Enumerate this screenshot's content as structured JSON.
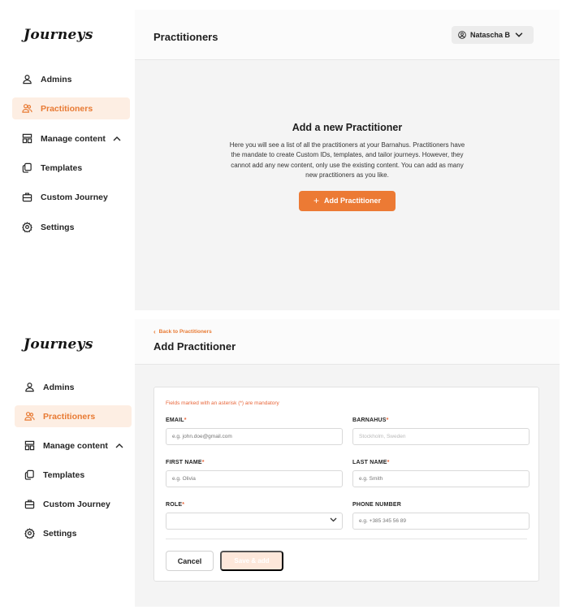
{
  "app": {
    "logo": "Journeys"
  },
  "sidebar": {
    "items": [
      {
        "label": "Admins",
        "icon": "user-icon"
      },
      {
        "label": "Practitioners",
        "icon": "users-icon"
      },
      {
        "label": "Manage content",
        "icon": "content-icon"
      },
      {
        "label": "Templates",
        "icon": "copy-icon"
      },
      {
        "label": "Custom Journey",
        "icon": "briefcase-icon"
      },
      {
        "label": "Settings",
        "icon": "gear-icon"
      }
    ]
  },
  "list_view": {
    "title": "Practitioners",
    "user": "Natascha B",
    "empty_title": "Add a new Practitioner",
    "empty_text": "Here you will see a list of all the practitioners at your Barnahus. Practitioners have the mandate to create Custom IDs, templates, and tailor journeys. However, they cannot add any new content, only use the existing content. You can add as many new practitioners as you like.",
    "add_button": "Add Practitioner",
    "add_button_plus": "+"
  },
  "form_view": {
    "back_link": "Back to Practitioners",
    "title": "Add Practitioner",
    "note": "Fields marked with an asterisk (*) are mandatory",
    "req_mark": "*",
    "fields": {
      "email": {
        "label": "EMAIL",
        "placeholder": "e.g. john.doe@gmail.com"
      },
      "barnahus": {
        "label": "BARNAHUS",
        "value": "Stockholm, Sweden"
      },
      "first_name": {
        "label": "FIRST NAME",
        "placeholder": "e.g. Olivia"
      },
      "last_name": {
        "label": "LAST NAME",
        "placeholder": "e.g. Smith"
      },
      "role": {
        "label": "ROLE",
        "value": ""
      },
      "phone": {
        "label": "PHONE NUMBER",
        "placeholder": "e.g. +385 345 56 89"
      }
    },
    "cancel": "Cancel",
    "save": "Save & add"
  },
  "colors": {
    "accent": "#ec7a34",
    "active_bg": "#fdeee3",
    "required": "#e8663a"
  }
}
